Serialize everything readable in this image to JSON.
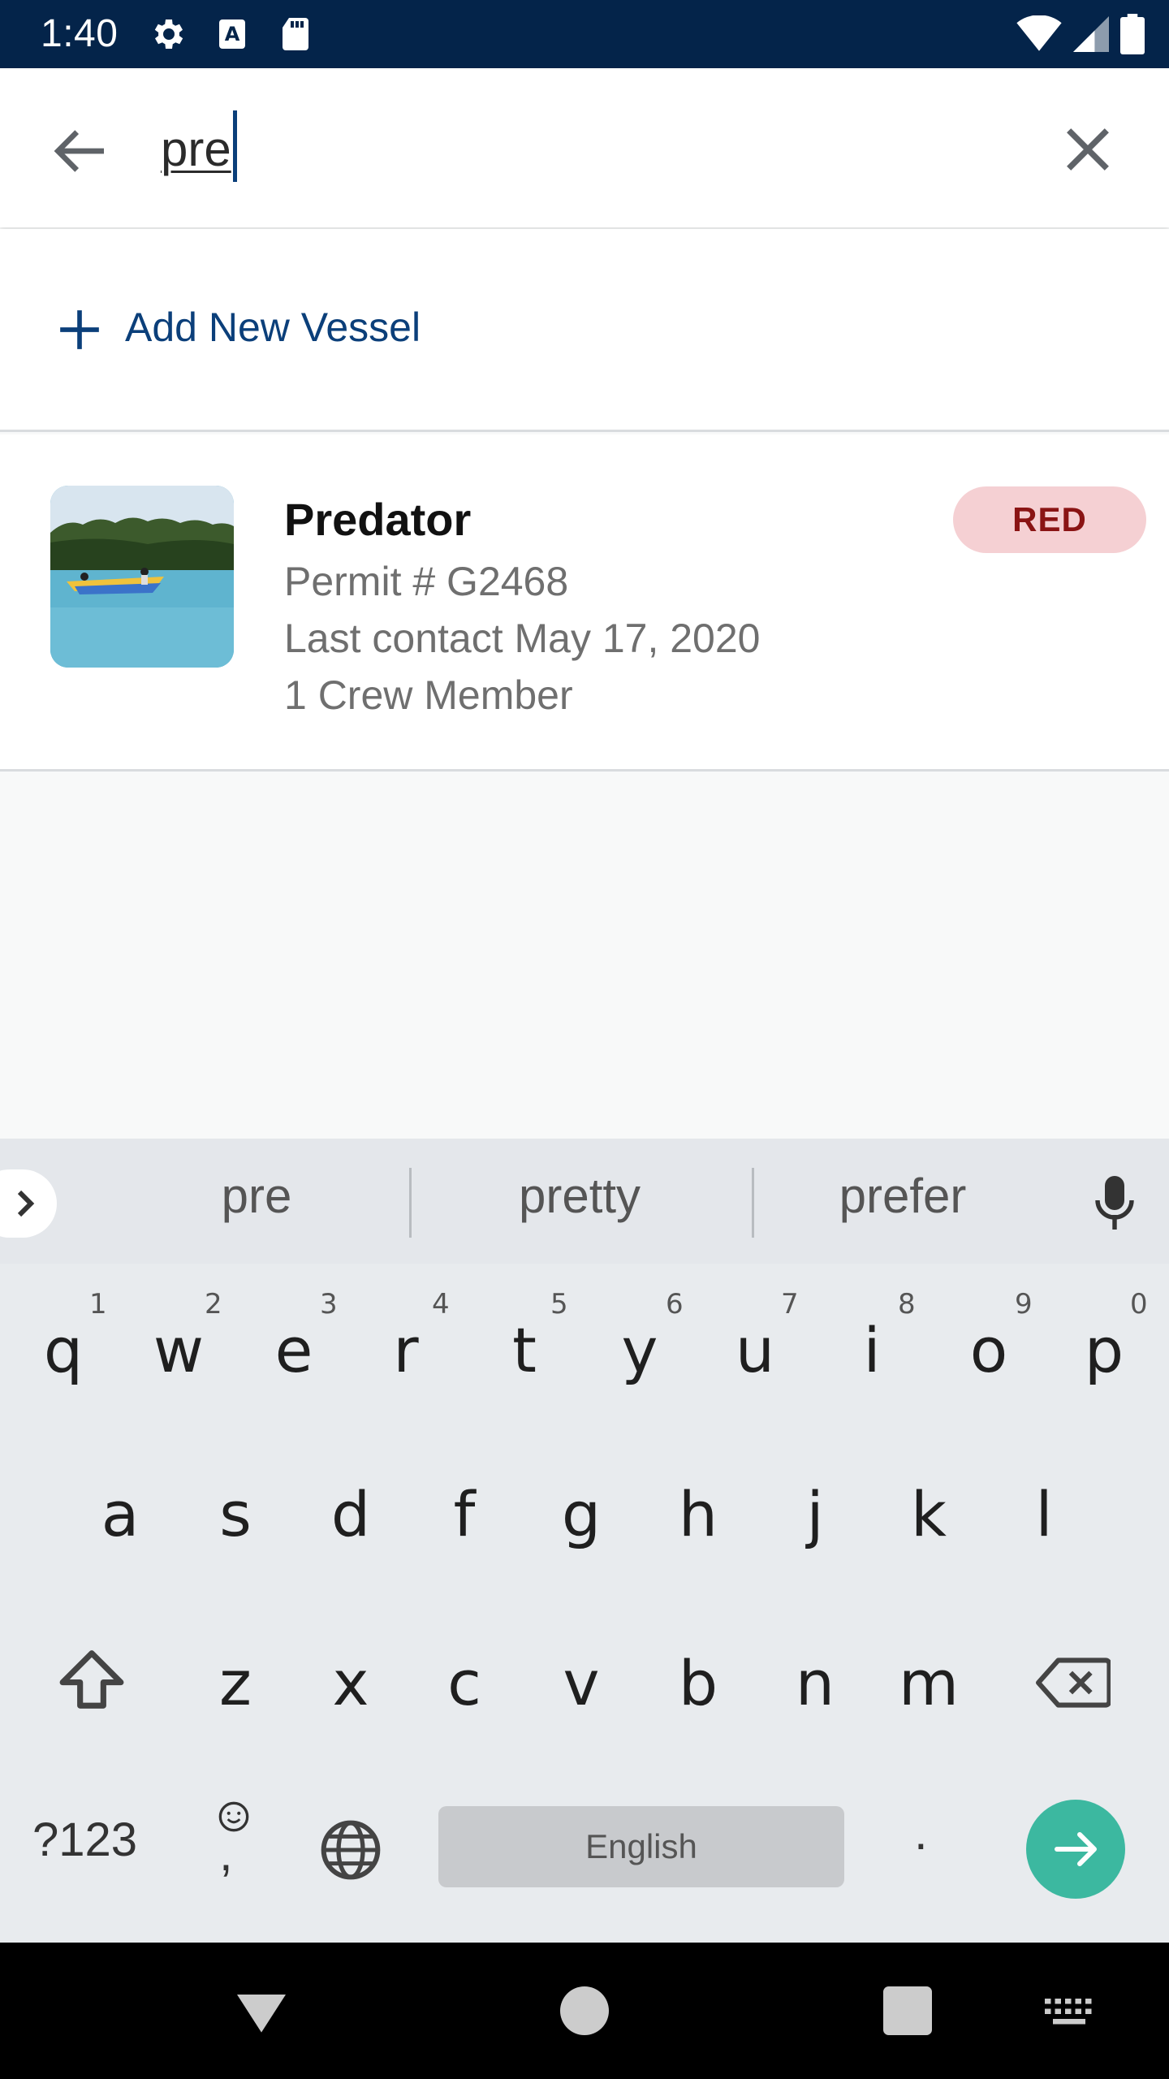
{
  "status_bar": {
    "time": "1:40",
    "icons": [
      "gear-icon",
      "text-a-icon",
      "sd-card-icon",
      "wifi-icon",
      "signal-icon",
      "battery-icon"
    ]
  },
  "search": {
    "value": "pre",
    "back_icon": "arrow-left-icon",
    "clear_icon": "close-icon"
  },
  "add_vessel": {
    "label": "Add New Vessel",
    "icon": "plus-icon"
  },
  "vessels": [
    {
      "name": "Predator",
      "permit": "Permit # G2468",
      "last_contact": "Last contact May 17, 2020",
      "crew": "1 Crew Member",
      "status": "RED"
    }
  ],
  "keyboard": {
    "suggestions": [
      "pre",
      "pretty",
      "prefer"
    ],
    "row1": [
      "q",
      "w",
      "e",
      "r",
      "t",
      "y",
      "u",
      "i",
      "o",
      "p"
    ],
    "row1_hints": [
      "1",
      "2",
      "3",
      "4",
      "5",
      "6",
      "7",
      "8",
      "9",
      "0"
    ],
    "row2": [
      "a",
      "s",
      "d",
      "f",
      "g",
      "h",
      "j",
      "k",
      "l"
    ],
    "row3": [
      "z",
      "x",
      "c",
      "v",
      "b",
      "n",
      "m"
    ],
    "symbols_label": "?123",
    "comma_label": ",",
    "space_label": "English",
    "period_label": "."
  },
  "colors": {
    "status_bar": "#04244a",
    "accent": "#0b3f7a",
    "badge_bg": "#f5d0d3",
    "badge_text": "#8a1414",
    "enter": "#3cb8a0"
  }
}
